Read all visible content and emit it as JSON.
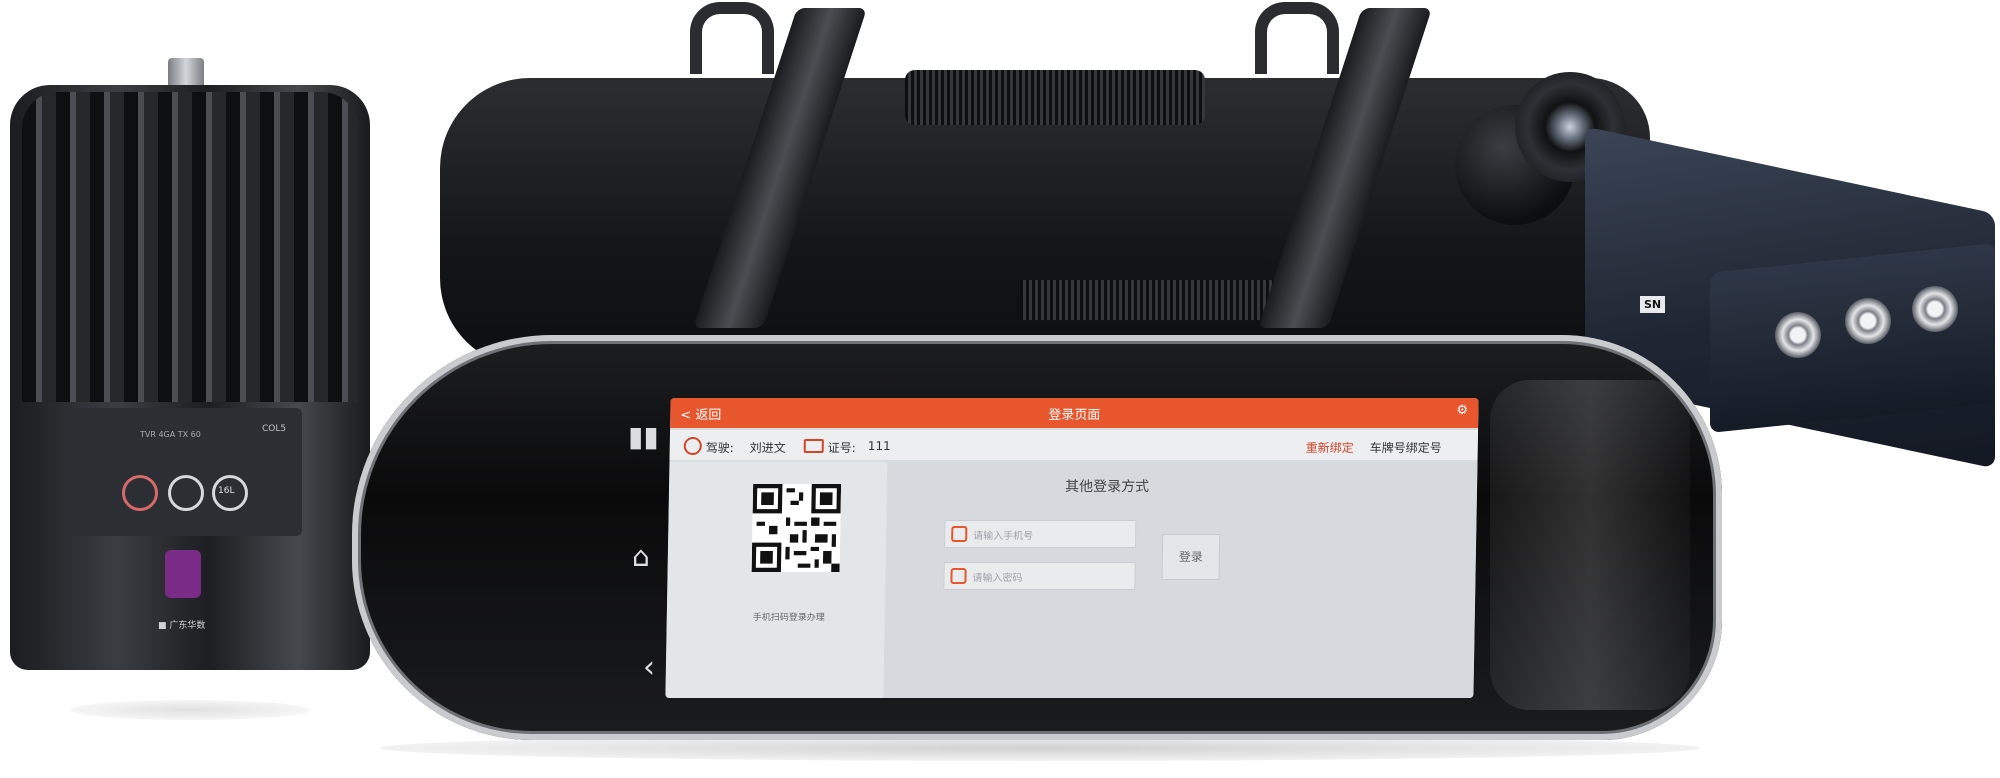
{
  "module": {
    "panel_text": "TVR 4GA TX 60",
    "color_label": "COL5",
    "button_labels": [
      "",
      "",
      "16L"
    ],
    "brand": "■ 广东华数"
  },
  "dvr": {
    "sn_label": "SN"
  },
  "screen": {
    "header": {
      "back_label": "< 返回",
      "title": "登录页面",
      "settings_icon": "gear-icon"
    },
    "info_row": {
      "driver_label": "驾驶:",
      "driver_name": "刘进文",
      "license_label": "证号:",
      "license_number": "111",
      "binding_status": "重新绑定",
      "plate_status": "车牌号绑定号"
    },
    "qr_caption": "手机扫码登录办理",
    "other_login": {
      "title": "其他登录方式",
      "account_placeholder": "请输入手机号",
      "password_placeholder": "请输入密码",
      "login_button": "登录"
    }
  },
  "colors": {
    "accent_orange": "#e8562e",
    "module_purple": "#7a2a87",
    "screen_bg": "#d9dde1"
  }
}
